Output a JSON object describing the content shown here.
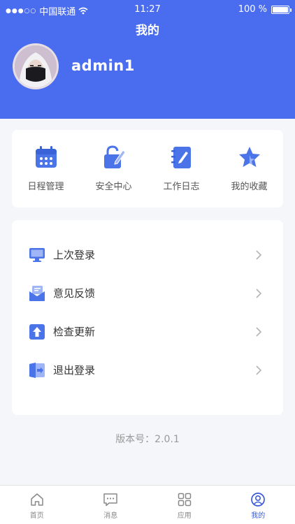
{
  "status_bar": {
    "carrier": "中国联通",
    "time": "11:27",
    "battery": "100 %",
    "battery_level": 1.0
  },
  "nav": {
    "title": "我的"
  },
  "profile": {
    "username": "admin1"
  },
  "quick_actions": [
    {
      "label": "日程管理",
      "icon": "calendar-icon"
    },
    {
      "label": "安全中心",
      "icon": "security-lock-icon"
    },
    {
      "label": "工作日志",
      "icon": "notebook-icon"
    },
    {
      "label": "我的收藏",
      "icon": "star-icon"
    }
  ],
  "menu": [
    {
      "label": "上次登录",
      "icon": "monitor-icon"
    },
    {
      "label": "意见反馈",
      "icon": "mail-icon"
    },
    {
      "label": "检查更新",
      "icon": "upload-arrow-icon"
    },
    {
      "label": "退出登录",
      "icon": "logout-door-icon"
    }
  ],
  "version": "版本号：2.0.1",
  "tabs": [
    {
      "label": "首页",
      "icon": "home-icon",
      "active": false
    },
    {
      "label": "消息",
      "icon": "message-icon",
      "active": false
    },
    {
      "label": "应用",
      "icon": "grid-icon",
      "active": false
    },
    {
      "label": "我的",
      "icon": "user-circle-icon",
      "active": true
    }
  ],
  "colors": {
    "primary": "#4a6df0",
    "icon_blue": "#4a74e8",
    "icon_light": "#9fb5f5",
    "tab_active": "#3b5bdb"
  }
}
